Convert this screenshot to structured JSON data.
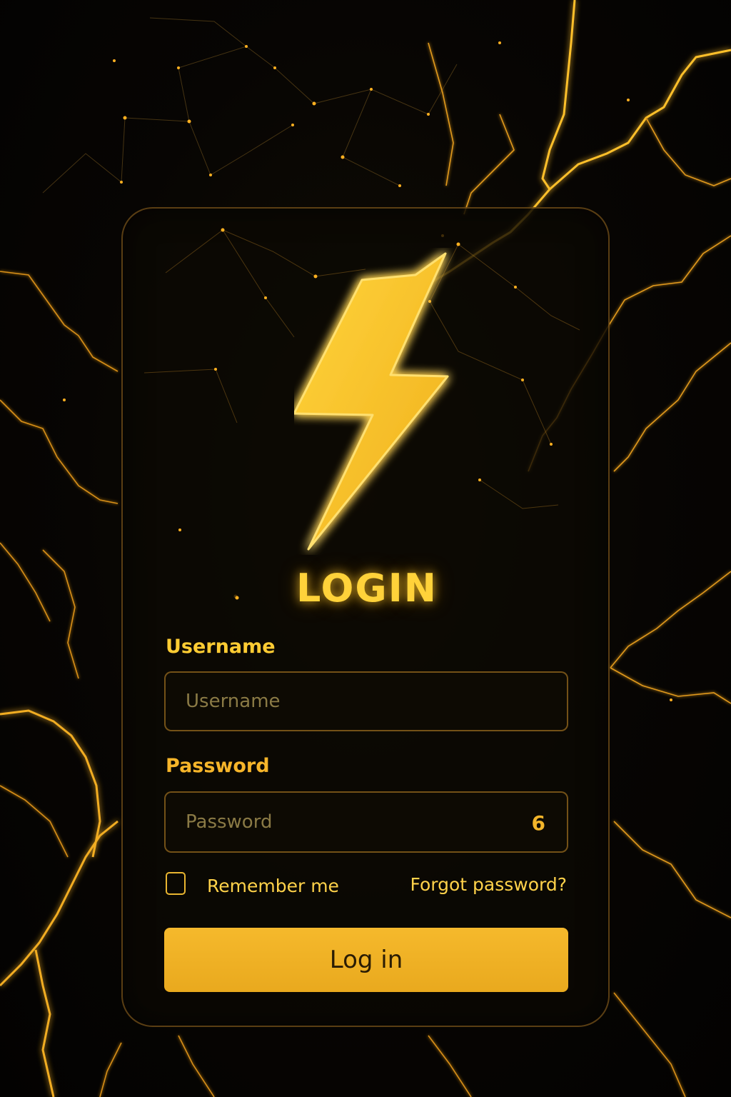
{
  "login": {
    "title": "LOGIN",
    "username": {
      "label": "Username",
      "placeholder": "Username",
      "value": ""
    },
    "password": {
      "label": "Password",
      "placeholder": "Password",
      "value": "",
      "hint": "6"
    },
    "remember_me": {
      "label": "Remember me",
      "checked": false
    },
    "forgot_password": "Forgot password?",
    "submit_label": "Log in"
  },
  "icons": {
    "logo": "lightning-bolt-icon"
  },
  "colors": {
    "accent": "#ffd23a",
    "button": "#f0b225",
    "background": "#050402",
    "border": "#c08a2a"
  }
}
